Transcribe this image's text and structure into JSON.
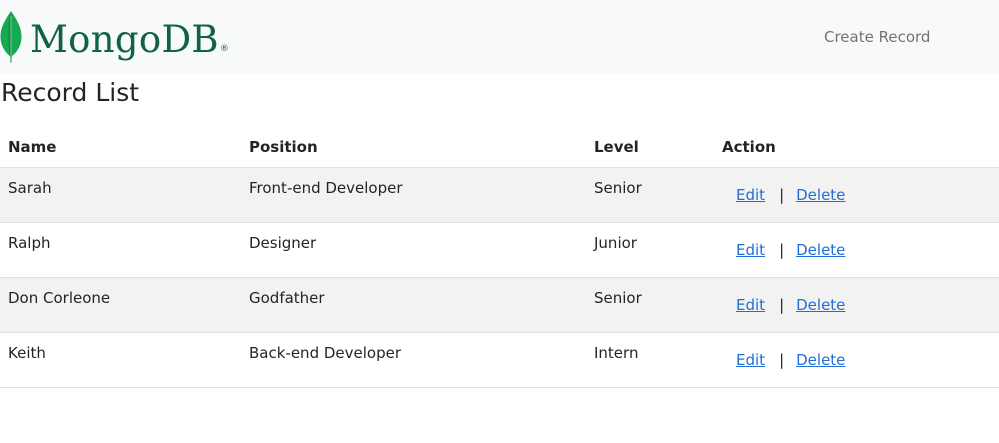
{
  "navbar": {
    "brand": {
      "text": "MongoDB",
      "registered": "®",
      "icon": "mongodb-leaf-icon",
      "color": "#116149",
      "leaf_color": "#13aa52"
    },
    "create_link": "Create Record"
  },
  "page": {
    "title": "Record List"
  },
  "table": {
    "headers": {
      "name": "Name",
      "position": "Position",
      "level": "Level",
      "action": "Action"
    },
    "rows": [
      {
        "name": "Sarah",
        "position": "Front-end Developer",
        "level": "Senior",
        "edit": "Edit",
        "separator": "|",
        "delete": "Delete"
      },
      {
        "name": "Ralph",
        "position": "Designer",
        "level": "Junior",
        "edit": "Edit",
        "separator": "|",
        "delete": "Delete"
      },
      {
        "name": "Don Corleone",
        "position": "Godfather",
        "level": "Senior",
        "edit": "Edit",
        "separator": "|",
        "delete": "Delete"
      },
      {
        "name": "Keith",
        "position": "Back-end Developer",
        "level": "Intern",
        "edit": "Edit",
        "separator": "|",
        "delete": "Delete"
      }
    ]
  },
  "colors": {
    "navbar_bg": "#f8f9fa",
    "link": "#1f6fd6",
    "striped_row": "#f2f2f2"
  }
}
